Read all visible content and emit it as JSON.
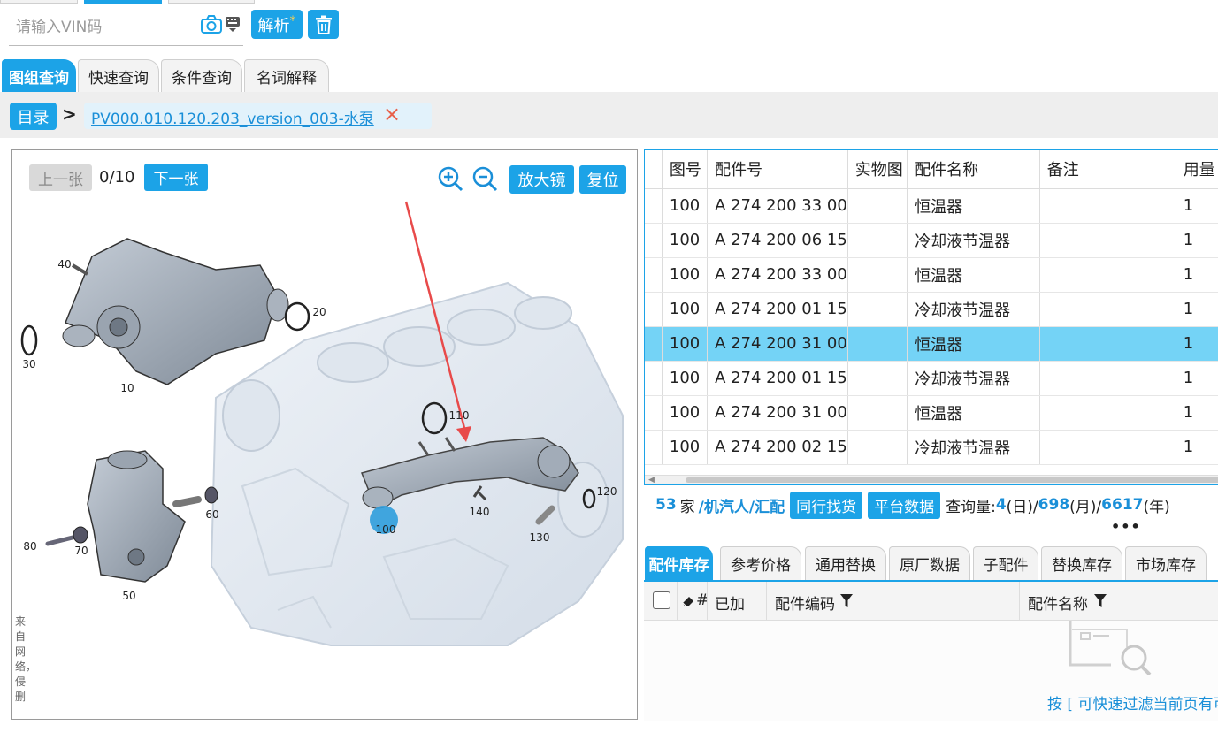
{
  "vin": {
    "placeholder": "请输入VIN码",
    "parse_label": "解析",
    "parse_mark": "*"
  },
  "main_tabs": [
    {
      "label": "图组查询",
      "active": true
    },
    {
      "label": "快速查询",
      "active": false
    },
    {
      "label": "条件查询",
      "active": false
    },
    {
      "label": "名词解释",
      "active": false
    }
  ],
  "breadcrumb": {
    "root": "目录",
    "separator": ">",
    "current": "PV000.010.120.203_version_003-水泵",
    "close": "×"
  },
  "viewer": {
    "prev_label": "上一张",
    "page": "0/10",
    "next_label": "下一张",
    "magnifier_label": "放大镜",
    "reset_label": "复位",
    "side_text": "来自网络，侵删",
    "callouts": [
      "40",
      "20",
      "30",
      "10",
      "110",
      "120",
      "100",
      "140",
      "130",
      "60",
      "80",
      "70",
      "50"
    ]
  },
  "parts_table": {
    "headers": [
      "图号",
      "配件号",
      "实物图",
      "配件名称",
      "备注",
      "用量"
    ],
    "rows": [
      {
        "fig": "100",
        "part_no": "A 274 200 33 00",
        "photo": "",
        "name": "恒温器",
        "note": "",
        "qty": "1"
      },
      {
        "fig": "100",
        "part_no": "A 274 200 06 15",
        "photo": "",
        "name": "冷却液节温器",
        "note": "",
        "qty": "1"
      },
      {
        "fig": "100",
        "part_no": "A 274 200 33 00",
        "photo": "",
        "name": "恒温器",
        "note": "",
        "qty": "1"
      },
      {
        "fig": "100",
        "part_no": "A 274 200 01 15",
        "photo": "",
        "name": "冷却液节温器",
        "note": "",
        "qty": "1"
      },
      {
        "fig": "100",
        "part_no": "A 274 200 31 00",
        "photo": "",
        "name": "恒温器",
        "note": "",
        "qty": "1"
      },
      {
        "fig": "100",
        "part_no": "A 274 200 01 15",
        "photo": "",
        "name": "冷却液节温器",
        "note": "",
        "qty": "1"
      },
      {
        "fig": "100",
        "part_no": "A 274 200 31 00",
        "photo": "",
        "name": "恒温器",
        "note": "",
        "qty": "1"
      },
      {
        "fig": "100",
        "part_no": "A 274 200 02 15",
        "photo": "",
        "name": "冷却液节温器",
        "note": "",
        "qty": "1"
      }
    ],
    "selected_row": 4
  },
  "stats": {
    "count": "53",
    "unit": "家",
    "sources": "/机汽人/汇配",
    "peer_btn": "同行找货",
    "platform_btn": "平台数据",
    "query_label": "查询量:",
    "day": "4",
    "day_unit": "(日)/",
    "month": "698",
    "month_unit": "(月)/",
    "year": "6617",
    "year_unit": "(年)"
  },
  "sub_tabs": [
    {
      "label": "配件库存",
      "active": true
    },
    {
      "label": "参考价格",
      "active": false
    },
    {
      "label": "通用替换",
      "active": false
    },
    {
      "label": "原厂数据",
      "active": false
    },
    {
      "label": "子配件",
      "active": false
    },
    {
      "label": "替换库存",
      "active": false
    },
    {
      "label": "市场库存",
      "active": false
    }
  ],
  "inventory": {
    "col_hash": "#",
    "col_added": "已加",
    "col_code": "配件编码",
    "col_name": "配件名称",
    "hint": "按 [ 可快速过滤当前页有可"
  },
  "colors": {
    "accent": "#1ca3e7",
    "selected_row": "#74d3f6",
    "link": "#1a8fd8",
    "arrow": "#e84a4a"
  }
}
